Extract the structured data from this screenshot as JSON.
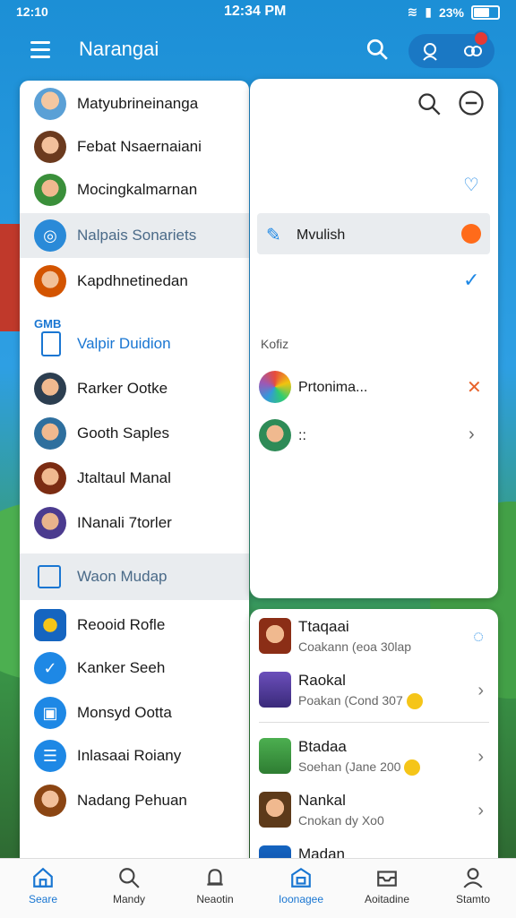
{
  "status_bar": {
    "left": "12:10",
    "time": "12:34 PM",
    "battery": "23%"
  },
  "app_bar": {
    "title": "Narangai"
  },
  "left_list": {
    "items": [
      {
        "label": "Matyubrineinanga"
      },
      {
        "label": "Febat Nsaernaiani"
      },
      {
        "label": "Mocingkalmarnan"
      },
      {
        "label": "Nalpais Sonariets"
      },
      {
        "label": "Kapdhnetinedan"
      }
    ],
    "section_label": "GMB",
    "section_item": "Valpir Duidion",
    "items2": [
      {
        "label": "Rarker Ootke"
      },
      {
        "label": "Gooth Saples"
      },
      {
        "label": "Jtaltaul Manal"
      },
      {
        "label": "INanali 7torler"
      },
      {
        "label": "Waon Mudap"
      },
      {
        "label": "Reooid Rofle"
      },
      {
        "label": "Kanker Seeh"
      },
      {
        "label": "Monsyd Ootta"
      },
      {
        "label": "Inlasaai Roiany"
      },
      {
        "label": "Nadang Pehuan"
      }
    ]
  },
  "right_top": {
    "selected_label": "Mvulish",
    "section_label": "Kofiz",
    "item1": "Prtonima...",
    "item2": "::"
  },
  "right_bottom": {
    "items": [
      {
        "title": "Ttaqaai",
        "subtitle": "Coakann (eoa 30lap"
      },
      {
        "title": "Raokal",
        "subtitle": "Poakan (Cond 307"
      },
      {
        "title": "Btadaa",
        "subtitle": "Soehan (Jane 200"
      },
      {
        "title": "Nankal",
        "subtitle": "Cnokan dy Xo0"
      },
      {
        "title": "Madan",
        "subtitle": ""
      }
    ]
  },
  "bottom_nav": {
    "tabs": [
      {
        "label": "Seare"
      },
      {
        "label": "Mandy"
      },
      {
        "label": "Neaotin"
      },
      {
        "label": "Ioonagee"
      },
      {
        "label": "Aoitadine"
      },
      {
        "label": "Stamto"
      }
    ],
    "active_index": 3
  },
  "colors": {
    "accent": "#1976d2",
    "status_bg": "#1c8fd6"
  }
}
